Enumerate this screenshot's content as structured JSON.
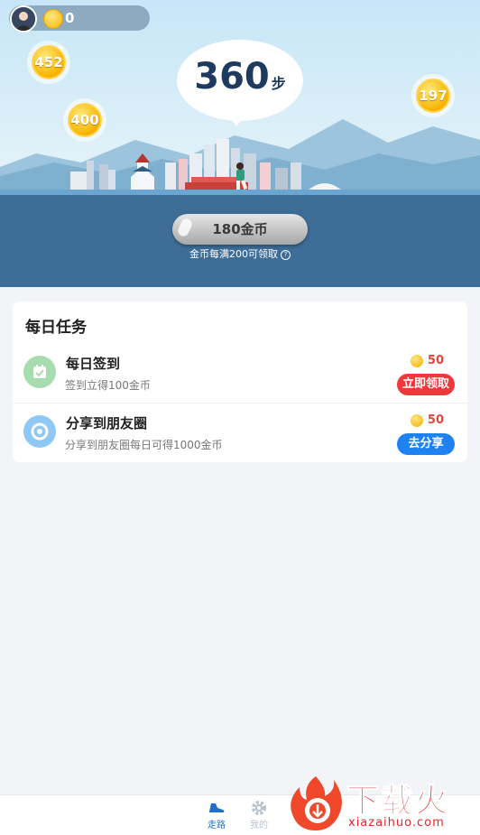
{
  "header": {
    "avatar_icon": "user-avatar",
    "coin_icon": "coin-icon",
    "coin_balance": "0"
  },
  "floating_coins": [
    {
      "value": "452"
    },
    {
      "value": "400"
    },
    {
      "value": "197"
    }
  ],
  "steps": {
    "count": "360",
    "unit": "步"
  },
  "collect_button": {
    "label": "180金币"
  },
  "collect_hint": "金币每满200可领取",
  "daily_tasks": {
    "title": "每日任务",
    "items": [
      {
        "name": "每日签到",
        "desc": "签到立得100金币",
        "reward": "50",
        "button": "立即领取",
        "button_color": "#f0383c",
        "icon": "calendar-check-icon",
        "icon_bg": "#a6dcae"
      },
      {
        "name": "分享到朋友圈",
        "desc": "分享到朋友圈每日可得1000金币",
        "reward": "50",
        "button": "去分享",
        "button_color": "#1f82f2",
        "icon": "moments-share-icon",
        "icon_bg": "#8fc8f5"
      }
    ]
  },
  "bottom_nav": [
    {
      "label": "走路",
      "icon": "shoe-icon",
      "active": true
    },
    {
      "label": "我的",
      "icon": "gear-icon",
      "active": false
    }
  ],
  "watermark": {
    "title": "下载火",
    "site": "xiazaihuo.com"
  },
  "colors": {
    "accent_red": "#e8453c",
    "accent_blue": "#1f82f2",
    "nav_active": "#1f6fc7",
    "nav_inactive": "#b8c3d0"
  }
}
